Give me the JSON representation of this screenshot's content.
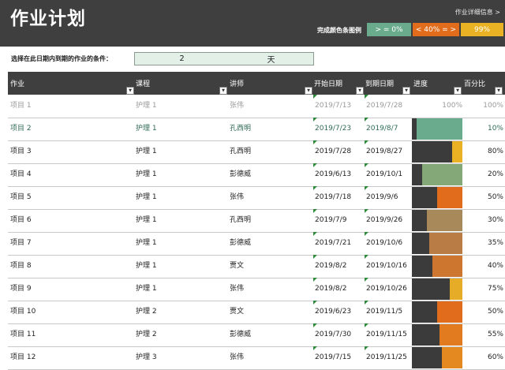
{
  "title": "作业计划",
  "detail_link": "作业详细信息 >",
  "legend": {
    "label": "完成颜色条图例",
    "items": [
      {
        "label": "> = 0%",
        "color": "#6aab8e"
      },
      {
        "label": "< 40% = >",
        "color": "#e06c1c"
      },
      {
        "label": "99%",
        "color": "#e8b224"
      }
    ]
  },
  "condition": {
    "label": "选择在此日期内到期的作业的条件：",
    "value": "2",
    "unit": "天"
  },
  "columns": {
    "task": "作业",
    "course": "课程",
    "lecturer": "讲师",
    "start": "开始日期",
    "due": "到期日期",
    "progress": "进度",
    "percent": "百分比"
  },
  "rows": [
    {
      "task": "项目 1",
      "course": "护理 1",
      "lecturer": "张伟",
      "start": "2019/7/13",
      "due": "2019/7/28",
      "progress_text": "100%",
      "percent": "100%",
      "value": 1.0,
      "color": "#ffffff",
      "state": "done"
    },
    {
      "task": "项目 2",
      "course": "护理 1",
      "lecturer": "孔西明",
      "start": "2019/7/23",
      "due": "2019/8/7",
      "progress_text": "",
      "percent": "10%",
      "value": 0.1,
      "color": "#6aab8e",
      "state": "teal"
    },
    {
      "task": "项目 3",
      "course": "护理 1",
      "lecturer": "孔西明",
      "start": "2019/7/28",
      "due": "2019/8/27",
      "progress_text": "",
      "percent": "80%",
      "value": 0.8,
      "color": "#e8b224",
      "state": ""
    },
    {
      "task": "项目 4",
      "course": "护理 1",
      "lecturer": "彭德威",
      "start": "2019/6/13",
      "due": "2019/10/1",
      "progress_text": "",
      "percent": "20%",
      "value": 0.2,
      "color": "#85a878",
      "state": ""
    },
    {
      "task": "项目 5",
      "course": "护理 1",
      "lecturer": "张伟",
      "start": "2019/7/18",
      "due": "2019/9/6",
      "progress_text": "",
      "percent": "50%",
      "value": 0.5,
      "color": "#e06c1c",
      "state": ""
    },
    {
      "task": "项目 6",
      "course": "护理 1",
      "lecturer": "孔西明",
      "start": "2019/7/9",
      "due": "2019/9/26",
      "progress_text": "",
      "percent": "30%",
      "value": 0.3,
      "color": "#a8895a",
      "state": ""
    },
    {
      "task": "项目 7",
      "course": "护理 1",
      "lecturer": "彭德威",
      "start": "2019/7/21",
      "due": "2019/10/6",
      "progress_text": "",
      "percent": "35%",
      "value": 0.35,
      "color": "#b97c45",
      "state": ""
    },
    {
      "task": "项目 8",
      "course": "护理 1",
      "lecturer": "贾文",
      "start": "2019/8/2",
      "due": "2019/10/16",
      "progress_text": "",
      "percent": "40%",
      "value": 0.4,
      "color": "#cd7630",
      "state": ""
    },
    {
      "task": "项目 9",
      "course": "护理 1",
      "lecturer": "张伟",
      "start": "2019/8/2",
      "due": "2019/10/26",
      "progress_text": "",
      "percent": "75%",
      "value": 0.75,
      "color": "#e6ac28",
      "state": ""
    },
    {
      "task": "项目 10",
      "course": "护理 2",
      "lecturer": "贾文",
      "start": "2019/6/23",
      "due": "2019/11/5",
      "progress_text": "",
      "percent": "50%",
      "value": 0.5,
      "color": "#e06c1c",
      "state": ""
    },
    {
      "task": "项目 11",
      "course": "护理 2",
      "lecturer": "彭德威",
      "start": "2019/7/30",
      "due": "2019/11/15",
      "progress_text": "",
      "percent": "55%",
      "value": 0.55,
      "color": "#e27a1f",
      "state": ""
    },
    {
      "task": "项目 12",
      "course": "护理 3",
      "lecturer": "张伟",
      "start": "2019/7/15",
      "due": "2019/11/25",
      "progress_text": "",
      "percent": "60%",
      "value": 0.6,
      "color": "#e4891f",
      "state": ""
    }
  ]
}
